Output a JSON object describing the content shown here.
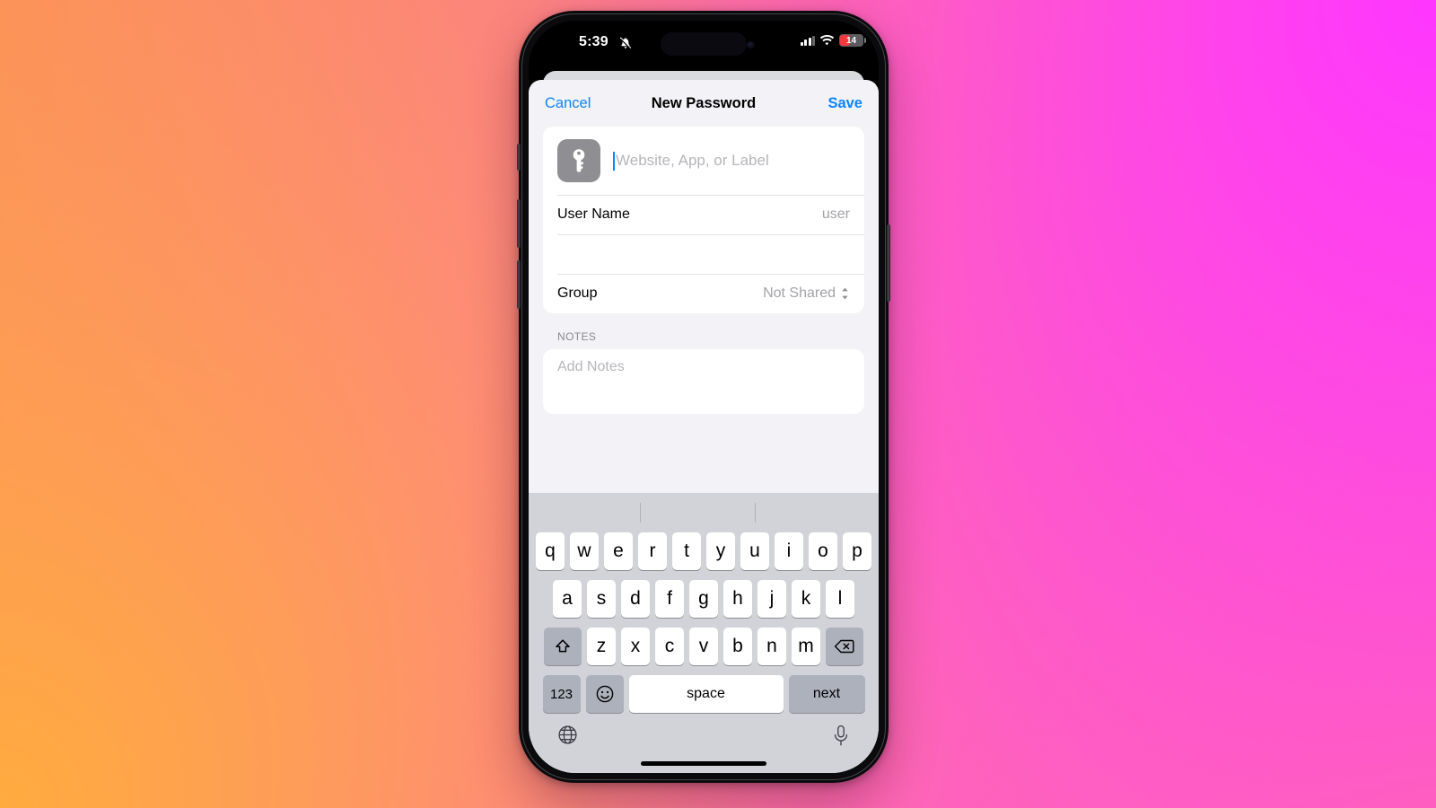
{
  "wallpaper": {
    "colors": {
      "top_left": "#fb8f5c",
      "top_right": "#ff36ff",
      "bottom_left": "#ffab3f",
      "bottom_right": "#ff63b8"
    }
  },
  "status_bar": {
    "time": "5:39",
    "silent_icon": "bell-slash-icon",
    "cellular_icon": "cellular-signal-icon",
    "signal_bars_active": 3,
    "signal_bars_total": 4,
    "wifi_icon": "wifi-icon",
    "battery_level": "14",
    "battery_color": "#f5373c"
  },
  "nav_bar": {
    "cancel_label": "Cancel",
    "title": "New Password",
    "save_label": "Save",
    "accent_color": "#0a84ff"
  },
  "form": {
    "service_row": {
      "icon": "key-icon",
      "placeholder": "Website, App, or Label",
      "value": ""
    },
    "rows": [
      {
        "label": "User Name",
        "value": "user",
        "trailing_icon": ""
      },
      {
        "label": "",
        "value": "",
        "trailing_icon": ""
      },
      {
        "label": "Group",
        "value": "Not Shared",
        "trailing_icon": "chevron-up-down-icon"
      }
    ]
  },
  "notes": {
    "header": "NOTES",
    "placeholder": "Add Notes",
    "value": ""
  },
  "keyboard": {
    "row1": [
      "q",
      "w",
      "e",
      "r",
      "t",
      "y",
      "u",
      "i",
      "o",
      "p"
    ],
    "row2": [
      "a",
      "s",
      "d",
      "f",
      "g",
      "h",
      "j",
      "k",
      "l"
    ],
    "row3": [
      "z",
      "x",
      "c",
      "v",
      "b",
      "n",
      "m"
    ],
    "shift_icon": "shift-up-arrow-icon",
    "backspace_icon": "backspace-delete-icon",
    "numbers_label": "123",
    "emoji_icon": "smiley-emoji-icon",
    "space_label": "space",
    "return_label": "next",
    "globe_icon": "globe-language-icon",
    "mic_icon": "microphone-dictation-icon"
  }
}
